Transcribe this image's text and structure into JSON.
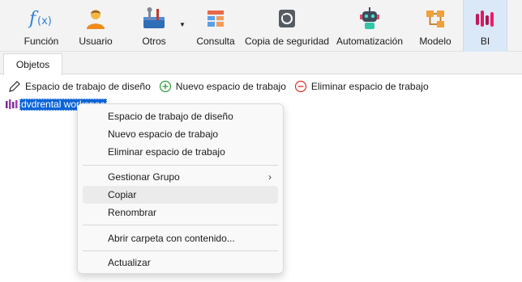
{
  "ribbon": {
    "buttons": [
      {
        "label": "Función",
        "icon": "function-icon"
      },
      {
        "label": "Usuario",
        "icon": "user-icon"
      },
      {
        "label": "Otros",
        "icon": "tools-icon"
      },
      {
        "label": "Consulta",
        "icon": "query-icon"
      },
      {
        "label": "Copia de seguridad",
        "icon": "backup-icon"
      },
      {
        "label": "Automatización",
        "icon": "robot-icon"
      },
      {
        "label": "Modelo",
        "icon": "model-icon"
      },
      {
        "label": "BI",
        "icon": "bi-icon"
      }
    ],
    "active": "BI",
    "accent": "#dbe8f7"
  },
  "tabs": [
    {
      "label": "Objetos"
    }
  ],
  "object_toolbar": {
    "design": "Espacio de trabajo de diseño",
    "new": "Nuevo espacio de trabajo",
    "delete": "Eliminar espacio de trabajo"
  },
  "tree": {
    "selected_item": "dvdrental workspace"
  },
  "context_menu": {
    "items": [
      {
        "label": "Espacio de trabajo de diseño"
      },
      {
        "label": "Nuevo espacio de trabajo"
      },
      {
        "label": "Eliminar espacio de trabajo"
      },
      {
        "label": "Gestionar Grupo",
        "submenu": "›"
      },
      {
        "label": "Copiar"
      },
      {
        "label": "Renombrar"
      },
      {
        "label": "Abrir carpeta con contenido..."
      },
      {
        "label": "Actualizar"
      }
    ],
    "hovered": "Copiar"
  }
}
